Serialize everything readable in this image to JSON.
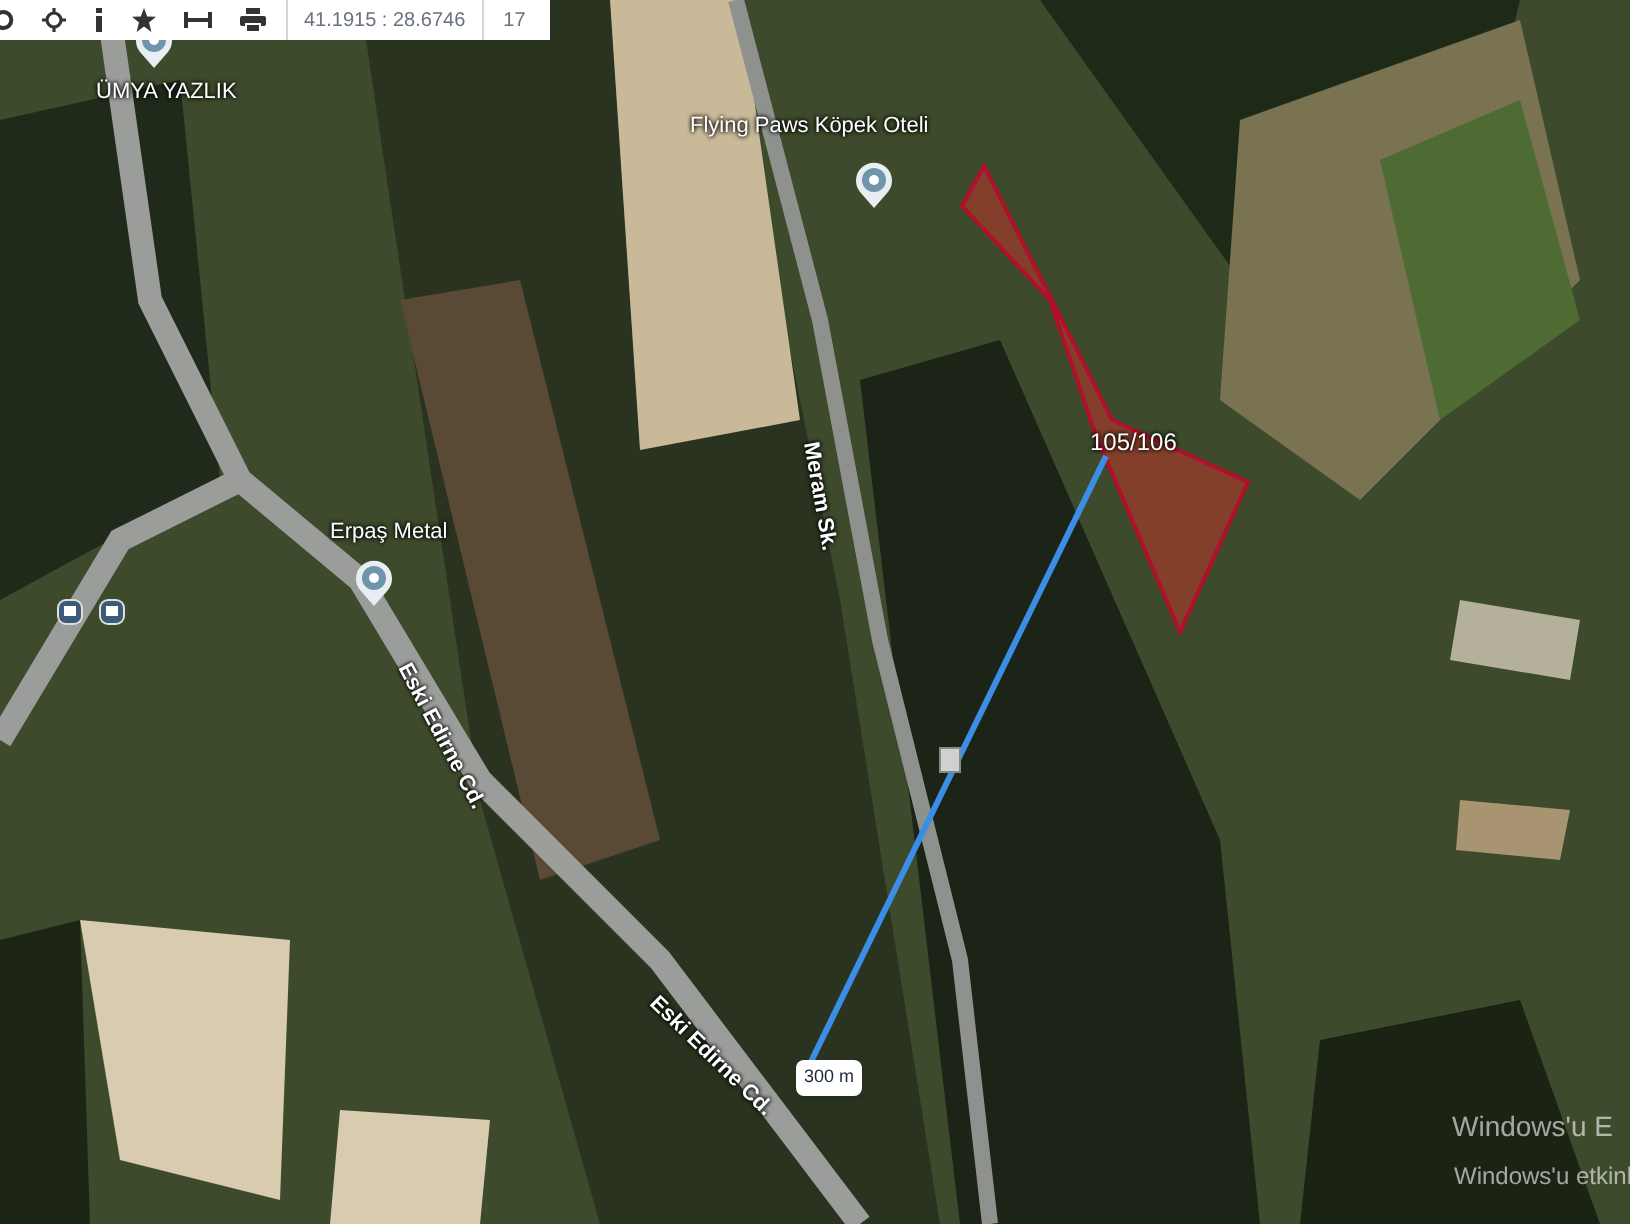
{
  "toolbar": {
    "coordinates": "41.1915 : 28.6746",
    "zoom_level": "17"
  },
  "map": {
    "places": [
      {
        "name": "ÜMYA YAZLIK"
      },
      {
        "name": "Flying Paws Köpek Oteli"
      },
      {
        "name": "Erpaş Metal"
      }
    ],
    "street_labels": [
      "Meram Sk.",
      "Eski Edirne Cd.",
      "Eski Edirne Cd."
    ],
    "parcel_label": "105/106",
    "distance_label": "300 m"
  },
  "os_notice": {
    "title": "Windows'u E",
    "subtitle": "Windows'u etkinl"
  }
}
